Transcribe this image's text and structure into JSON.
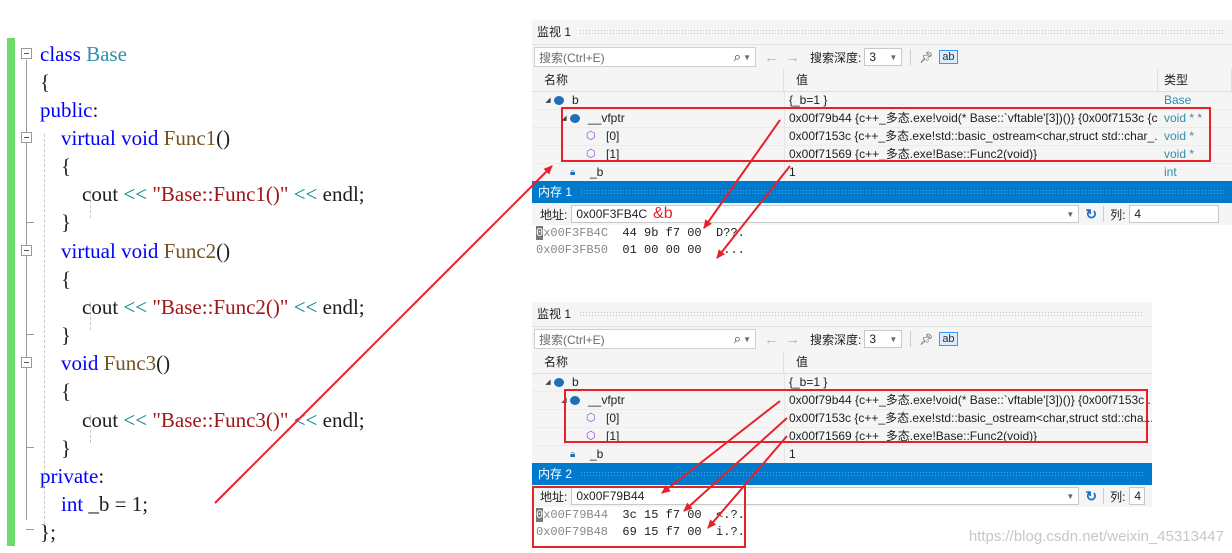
{
  "editor": {
    "lines": [
      {
        "parts": [
          [
            "kw",
            "class "
          ],
          [
            "type",
            "Base"
          ]
        ]
      },
      {
        "parts": [
          [
            "punct",
            "{"
          ]
        ]
      },
      {
        "parts": [
          [
            "kw",
            "public"
          ],
          [
            "punct",
            ":"
          ]
        ]
      },
      {
        "parts": [
          [
            "kw",
            "    virtual void "
          ],
          [
            "fn",
            "Func1"
          ],
          [
            "punct",
            "()"
          ]
        ]
      },
      {
        "parts": [
          [
            "punct",
            "    {"
          ]
        ]
      },
      {
        "parts": [
          [
            "punct",
            "        cout "
          ],
          [
            "op",
            "<<"
          ],
          [
            "str",
            " \"Base::Func1()\" "
          ],
          [
            "op",
            "<<"
          ],
          [
            "punct",
            " endl;"
          ]
        ]
      },
      {
        "parts": [
          [
            "punct",
            "    }"
          ]
        ]
      },
      {
        "parts": [
          [
            "kw",
            "    virtual void "
          ],
          [
            "fn",
            "Func2"
          ],
          [
            "punct",
            "()"
          ]
        ]
      },
      {
        "parts": [
          [
            "punct",
            "    {"
          ]
        ]
      },
      {
        "parts": [
          [
            "punct",
            "        cout "
          ],
          [
            "op",
            "<<"
          ],
          [
            "str",
            " \"Base::Func2()\" "
          ],
          [
            "op",
            "<<"
          ],
          [
            "punct",
            " endl;"
          ]
        ]
      },
      {
        "parts": [
          [
            "punct",
            "    }"
          ]
        ]
      },
      {
        "parts": [
          [
            "kw",
            "    void "
          ],
          [
            "fn",
            "Func3"
          ],
          [
            "punct",
            "()"
          ]
        ]
      },
      {
        "parts": [
          [
            "punct",
            "    {"
          ]
        ]
      },
      {
        "parts": [
          [
            "punct",
            "        cout "
          ],
          [
            "op",
            "<<"
          ],
          [
            "str",
            " \"Base::Func3()\" "
          ],
          [
            "op",
            "<<"
          ],
          [
            "punct",
            " endl;"
          ]
        ]
      },
      {
        "parts": [
          [
            "punct",
            "    }"
          ]
        ]
      },
      {
        "parts": [
          [
            "kw",
            "private"
          ],
          [
            "punct",
            ":"
          ]
        ]
      },
      {
        "parts": [
          [
            "kw",
            "    int "
          ],
          [
            "punct",
            "_b = 1;"
          ]
        ]
      },
      {
        "parts": [
          [
            "punct",
            "};"
          ]
        ]
      }
    ]
  },
  "watch_top": {
    "title": "监视 1",
    "search_placeholder": "搜索(Ctrl+E)",
    "search_icon": "magnifier-icon",
    "back_icon": "←",
    "forward_icon": "→",
    "depth_label": "搜索深度:",
    "depth_value": "3",
    "filter_icon": "pin-filter-icon",
    "hex_icon": "hex-display-icon",
    "columns": {
      "name": "名称",
      "value": "值",
      "type": "类型"
    },
    "rows": [
      {
        "name": "b",
        "value": "{_b=1 }",
        "type": "Base"
      },
      {
        "name": "__vfptr",
        "value": "0x00f79b44 {c++_多态.exe!void(* Base::`vftable'[3])()} {0x00f7153c {c...",
        "type": "void * *"
      },
      {
        "name": "[0]",
        "value": "0x00f7153c {c++_多态.exe!std::basic_ostream<char,struct std::char_...",
        "type": "void *"
      },
      {
        "name": "[1]",
        "value": "0x00f71569 {c++_多态.exe!Base::Func2(void)}",
        "type": "void *"
      },
      {
        "name": "_b",
        "value": "1",
        "type": "int"
      }
    ]
  },
  "memory_top": {
    "title": "内存 1",
    "address_label": "地址:",
    "address_value": "0x00F3FB4C",
    "annotation": "&b",
    "columns_label": "列:",
    "columns_value": "4",
    "rows": [
      {
        "cursor": "0",
        "addr": "x00F3FB4C",
        "bytes": "  44 9b f7 00  ",
        "ascii": "D??."
      },
      {
        "cursor": "",
        "addr": "0x00F3FB50",
        "bytes": "  01 00 00 00  ",
        "ascii": "...."
      }
    ]
  },
  "watch_bottom": {
    "title": "监视 1",
    "search_placeholder": "搜索(Ctrl+E)",
    "back_icon": "←",
    "forward_icon": "→",
    "depth_label": "搜索深度:",
    "depth_value": "3",
    "columns": {
      "name": "名称",
      "value": "值"
    },
    "rows": [
      {
        "name": "b",
        "value": "{_b=1 }"
      },
      {
        "name": "__vfptr",
        "value": "0x00f79b44 {c++_多态.exe!void(* Base::`vftable'[3])()} {0x00f7153c ..."
      },
      {
        "name": "[0]",
        "value": "0x00f7153c {c++_多态.exe!std::basic_ostream<char,struct std::cha..."
      },
      {
        "name": "[1]",
        "value": "0x00f71569 {c++_多态.exe!Base::Func2(void)}"
      },
      {
        "name": "_b",
        "value": "1"
      }
    ]
  },
  "memory_bottom": {
    "title": "内存 2",
    "address_label": "地址:",
    "address_value": "0x00F79B44",
    "columns_label": "列:",
    "columns_value": "4",
    "rows": [
      {
        "cursor": "0",
        "addr": "x00F79B44",
        "bytes": "  3c 15 f7 00  ",
        "ascii": "<.?."
      },
      {
        "cursor": "",
        "addr": "0x00F79B48",
        "bytes": "  69 15 f7 00  ",
        "ascii": "i.?."
      }
    ]
  },
  "watermark": "https://blog.csdn.net/weixin_45313447",
  "colors": {
    "annotation_red": "#e8202a",
    "memory_title_blue": "#007acc",
    "change_bar_green": "#6ddc6d"
  }
}
